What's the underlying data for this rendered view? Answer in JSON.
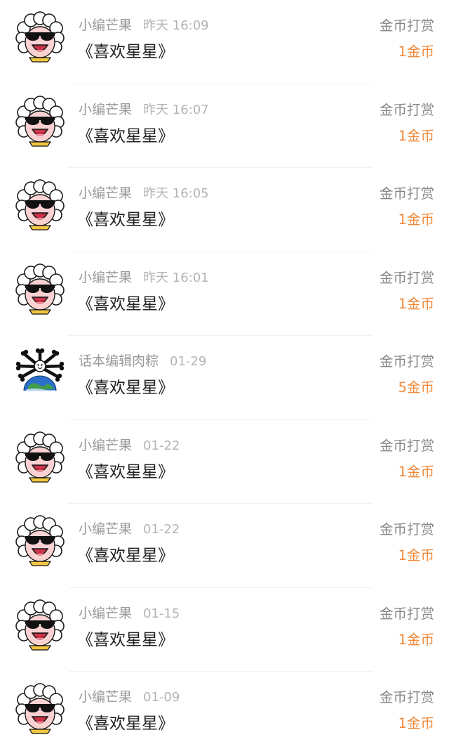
{
  "items": [
    {
      "name": "小编芒果",
      "time": "昨天 16:09",
      "title": "《喜欢星星》",
      "type": "金币打赏",
      "amount": "1金币",
      "avatar": "sheep-sunglasses-avatar"
    },
    {
      "name": "小编芒果",
      "time": "昨天 16:07",
      "title": "《喜欢星星》",
      "type": "金币打赏",
      "amount": "1金币",
      "avatar": "sheep-sunglasses-avatar"
    },
    {
      "name": "小编芒果",
      "time": "昨天 16:05",
      "title": "《喜欢星星》",
      "type": "金币打赏",
      "amount": "1金币",
      "avatar": "sheep-sunglasses-avatar"
    },
    {
      "name": "小编芒果",
      "time": "昨天 16:01",
      "title": "《喜欢星星》",
      "type": "金币打赏",
      "amount": "1金币",
      "avatar": "sheep-sunglasses-avatar"
    },
    {
      "name": "话本编辑肉粽",
      "time": "01-29",
      "title": "《喜欢星星》",
      "type": "金币打赏",
      "amount": "5金币",
      "avatar": "earth-bones-avatar"
    },
    {
      "name": "小编芒果",
      "time": "01-22",
      "title": "《喜欢星星》",
      "type": "金币打赏",
      "amount": "1金币",
      "avatar": "sheep-sunglasses-avatar"
    },
    {
      "name": "小编芒果",
      "time": "01-22",
      "title": "《喜欢星星》",
      "type": "金币打赏",
      "amount": "1金币",
      "avatar": "sheep-sunglasses-avatar"
    },
    {
      "name": "小编芒果",
      "time": "01-15",
      "title": "《喜欢星星》",
      "type": "金币打赏",
      "amount": "1金币",
      "avatar": "sheep-sunglasses-avatar"
    },
    {
      "name": "小编芒果",
      "time": "01-09",
      "title": "《喜欢星星》",
      "type": "金币打赏",
      "amount": "1金币",
      "avatar": "sheep-sunglasses-avatar"
    }
  ],
  "colors": {
    "amount": "#f08a3c",
    "name": "#9a9a9a",
    "time": "#b4b4b4",
    "title": "#222222",
    "type": "#888888"
  }
}
